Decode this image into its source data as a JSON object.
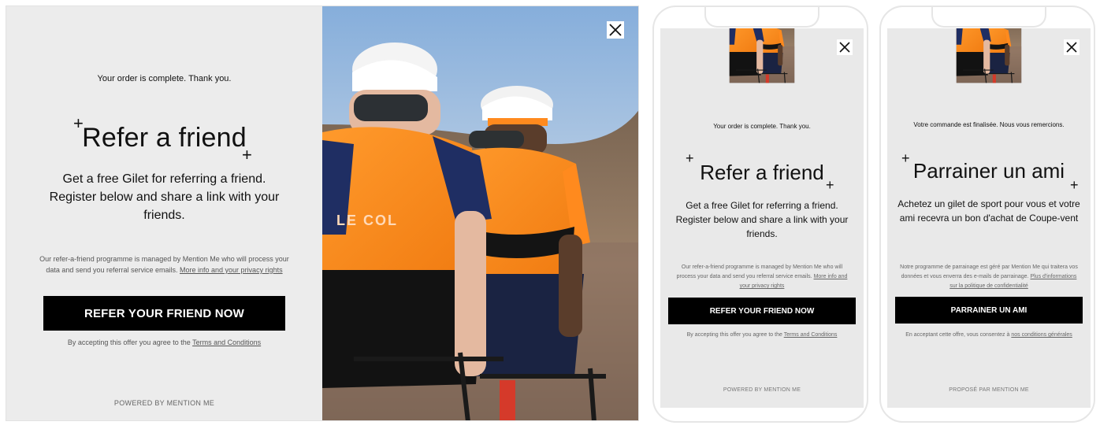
{
  "desktop": {
    "order_text": "Your order is complete. Thank you.",
    "headline": "Refer a friend",
    "description": "Get a free Gilet for referring a friend. Register below and share a link with your friends.",
    "legal_text": "Our refer-a-friend programme is managed by Mention Me who will process your data and send you referral service emails.",
    "legal_link": "More info and your privacy rights",
    "cta_label": "REFER YOUR FRIEND NOW",
    "terms_text": "By accepting this offer you agree to the",
    "terms_link": "Terms and Conditions",
    "powered_by": "POWERED BY MENTION ME",
    "jersey_brand": "LE COL"
  },
  "mobile_en": {
    "order_text": "Your order is complete. Thank you.",
    "headline": "Refer a friend",
    "description": "Get a free Gilet for referring a friend. Register below and share a link with your friends.",
    "legal_text": "Our refer-a-friend programme is managed by Mention Me who will process your data and send you referral service emails.",
    "legal_link": "More info and your privacy rights",
    "cta_label": "REFER YOUR FRIEND NOW",
    "terms_text": "By accepting this offer you agree to the",
    "terms_link": "Terms and Conditions",
    "powered_by": "POWERED BY MENTION ME"
  },
  "mobile_fr": {
    "order_text": "Votre commande est finalisée. Nous vous remercions.",
    "headline": "Parrainer un ami",
    "description": "Achetez un gilet de sport pour vous et votre ami recevra un bon d'achat de Coupe-vent",
    "legal_text": "Notre programme de parrainage est géré par Mention Me qui traitera vos données et vous enverra des e-mails de parrainage.",
    "legal_link": "Plus d'informations sur la politique de confidentialité",
    "cta_label": "PARRAINER UN AMI",
    "terms_text": "En acceptant cette offre, vous consentez à",
    "terms_link": "nos conditions générales",
    "powered_by": "PROPOSÉ PAR MENTION ME"
  },
  "icons": {
    "close": "close-icon",
    "plus": "plus-icon"
  },
  "colors": {
    "modal_bg": "#ececec",
    "cta_bg": "#000000",
    "cta_text": "#ffffff",
    "jersey_orange": "#ff8a1e",
    "jersey_navy": "#1f2e63"
  }
}
